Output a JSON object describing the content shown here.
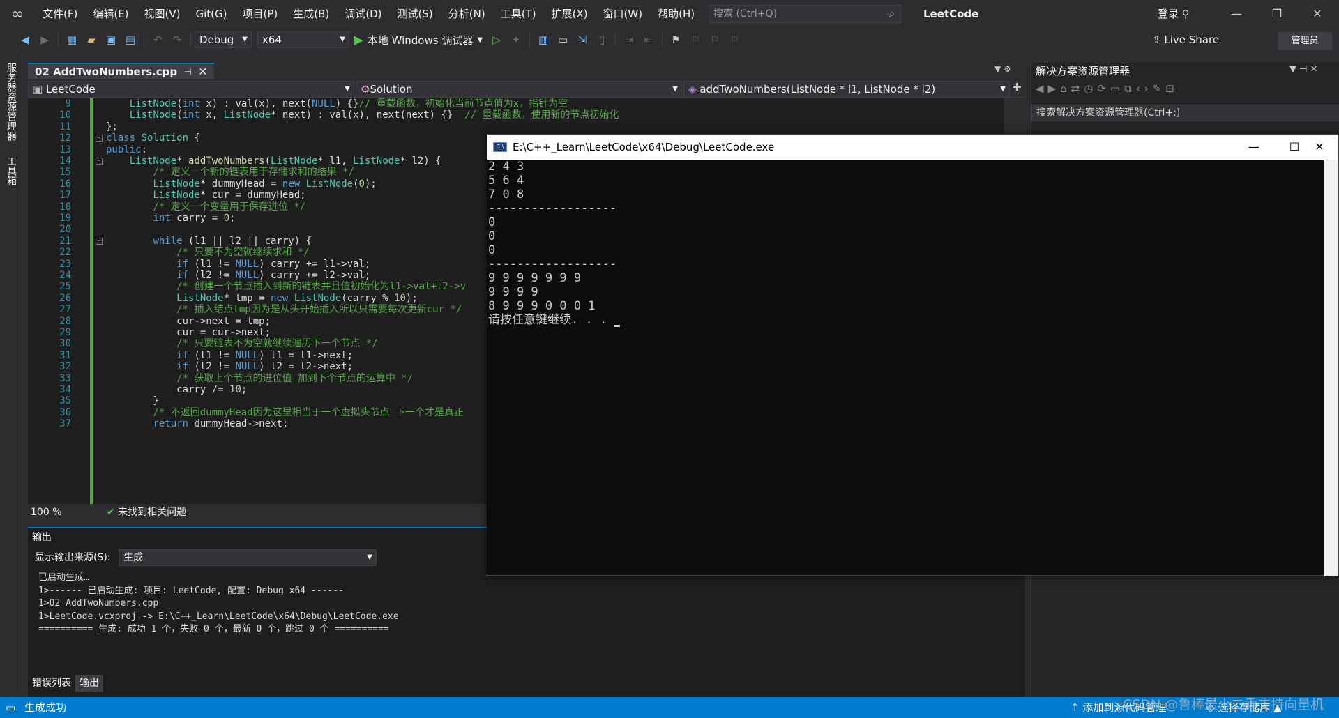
{
  "menubar": {
    "items": [
      "文件(F)",
      "编辑(E)",
      "视图(V)",
      "Git(G)",
      "项目(P)",
      "生成(B)",
      "调试(D)",
      "测试(S)",
      "分析(N)",
      "工具(T)",
      "扩展(X)",
      "窗口(W)",
      "帮助(H)"
    ],
    "search_placeholder": "搜索 (Ctrl+Q)",
    "app_title": "LeetCode",
    "login_label": "登录"
  },
  "toolbar": {
    "config": "Debug",
    "platform": "x64",
    "run_label": "本地 Windows 调试器",
    "live_share": "Live Share",
    "admin": "管理员"
  },
  "left_tabs": [
    "服务器资源管理器",
    "工具箱"
  ],
  "editor": {
    "tab_title": "02 AddTwoNumbers.cpp",
    "nav_project": "LeetCode",
    "nav_scope": "Solution",
    "nav_member": "addTwoNumbers(ListNode * l1, ListNode * l2)",
    "zoom": "100 %",
    "issues": "未找到相关问题",
    "lines": [
      {
        "n": "9",
        "t": "    ListNode(int x) : val(x), next(NULL) {}// 重载函数，初始化当前节点值为x，指针为空"
      },
      {
        "n": "10",
        "t": "    ListNode(int x, ListNode* next) : val(x), next(next) {}  // 重载函数，使用新的节点初始化"
      },
      {
        "n": "11",
        "t": "};"
      },
      {
        "n": "12",
        "t": "class Solution {"
      },
      {
        "n": "13",
        "t": "public:"
      },
      {
        "n": "14",
        "t": "    ListNode* addTwoNumbers(ListNode* l1, ListNode* l2) {"
      },
      {
        "n": "15",
        "t": "        /* 定义一个新的链表用于存储求和的结果 */"
      },
      {
        "n": "16",
        "t": "        ListNode* dummyHead = new ListNode(0);"
      },
      {
        "n": "17",
        "t": "        ListNode* cur = dummyHead;"
      },
      {
        "n": "18",
        "t": "        /* 定义一个变量用于保存进位 */"
      },
      {
        "n": "19",
        "t": "        int carry = 0;"
      },
      {
        "n": "20",
        "t": ""
      },
      {
        "n": "21",
        "t": "        while (l1 || l2 || carry) {"
      },
      {
        "n": "22",
        "t": "            /* 只要不为空就继续求和 */"
      },
      {
        "n": "23",
        "t": "            if (l1 != NULL) carry += l1->val;"
      },
      {
        "n": "24",
        "t": "            if (l2 != NULL) carry += l2->val;"
      },
      {
        "n": "25",
        "t": "            /* 创建一个节点插入到新的链表并且值初始化为l1->val+l2->v"
      },
      {
        "n": "26",
        "t": "            ListNode* tmp = new ListNode(carry % 10);"
      },
      {
        "n": "27",
        "t": "            /* 插入结点tmp因为是从头开始插入所以只需要每次更新cur */"
      },
      {
        "n": "28",
        "t": "            cur->next = tmp;"
      },
      {
        "n": "29",
        "t": "            cur = cur->next;"
      },
      {
        "n": "30",
        "t": "            /* 只要链表不为空就继续遍历下一个节点 */"
      },
      {
        "n": "31",
        "t": "            if (l1 != NULL) l1 = l1->next;"
      },
      {
        "n": "32",
        "t": "            if (l2 != NULL) l2 = l2->next;"
      },
      {
        "n": "33",
        "t": "            /* 获取上个节点的进位值 加到下个节点的运算中 */"
      },
      {
        "n": "34",
        "t": "            carry /= 10;"
      },
      {
        "n": "35",
        "t": "        }"
      },
      {
        "n": "36",
        "t": "        /* 不返回dummyHead因为这里相当于一个虚拟头节点 下一个才是真正"
      },
      {
        "n": "37",
        "t": "        return dummyHead->next;"
      }
    ]
  },
  "output": {
    "title": "输出",
    "source_label": "显示输出来源(S):",
    "source_value": "生成",
    "text": "已启动生成…\n1>------ 已启动生成: 项目: LeetCode, 配置: Debug x64 ------\n1>02 AddTwoNumbers.cpp\n1>LeetCode.vcxproj -> E:\\C++_Learn\\LeetCode\\x64\\Debug\\LeetCode.exe\n========== 生成: 成功 1 个，失败 0 个，最新 0 个，跳过 0 个 ==========",
    "tabs": [
      "错误列表",
      "输出"
    ]
  },
  "solution": {
    "title": "解决方案资源管理器",
    "search_placeholder": "搜索解决方案资源管理器(Ctrl+;)"
  },
  "console": {
    "title": "E:\\C++_Learn\\LeetCode\\x64\\Debug\\LeetCode.exe",
    "text": "2 4 3\n5 6 4\n7 0 8\n------------------\n0\n0\n0\n------------------\n9 9 9 9 9 9 9\n9 9 9 9\n8 9 9 9 0 0 0 1\n请按任意键继续. . . "
  },
  "statusbar": {
    "left": "生成成功",
    "add_source": "添加到源代码管理",
    "select_repo": "选择存储库"
  },
  "watermark": "CSDN @鲁棒最小二乘支持向量机"
}
